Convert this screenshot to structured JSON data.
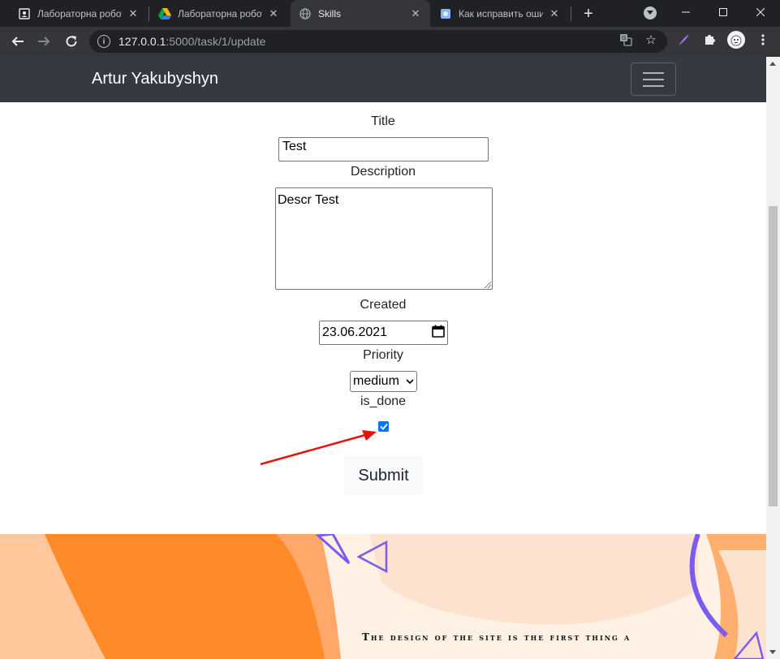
{
  "browser": {
    "tabs": [
      {
        "title": "Лабораторна робота",
        "icon": "classroom-icon",
        "active": false
      },
      {
        "title": "Лабораторна робота",
        "icon": "google-drive-icon",
        "active": false
      },
      {
        "title": "Skills",
        "icon": "globe-icon",
        "active": true
      },
      {
        "title": "Как исправить ошибку",
        "icon": "page-icon",
        "active": false
      }
    ],
    "url_host": "127.0.0.1",
    "url_path": ":5000/task/1/update"
  },
  "navbar": {
    "brand": "Artur Yakubyshyn"
  },
  "form": {
    "title_label": "Title",
    "title_value": "Test",
    "description_label": "Description",
    "description_value": "Descr Test",
    "created_label": "Created",
    "created_value": "23.06.2021",
    "priority_label": "Priority",
    "priority_value": "medium",
    "is_done_label": "is_done",
    "is_done_checked": true,
    "submit_label": "Submit"
  },
  "banner": {
    "text": "The design of the site is the first thing a"
  },
  "colors": {
    "navbar": "#343a40",
    "checkbox": "#0075ff",
    "annotation_arrow": "#e8120c",
    "banner_orange": "#ff8a2a"
  }
}
